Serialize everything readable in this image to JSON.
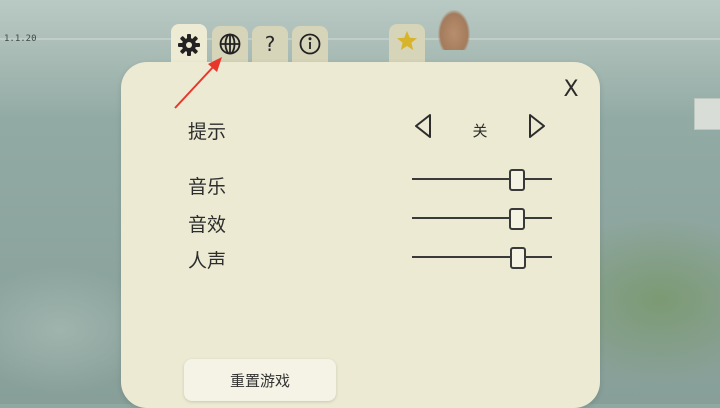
{
  "version": "1.1.20",
  "tabs": [
    {
      "id": "settings",
      "icon": "gear-icon"
    },
    {
      "id": "language",
      "icon": "globe-icon"
    },
    {
      "id": "help",
      "label": "?",
      "icon": "question-icon"
    },
    {
      "id": "info",
      "icon": "info-icon"
    }
  ],
  "star_tab": {
    "icon": "star-icon",
    "color": "#d8b42a"
  },
  "close_label": "X",
  "settings": {
    "hint": {
      "label": "提示",
      "value": "关"
    },
    "music": {
      "label": "音乐",
      "level": 0.75
    },
    "sfx": {
      "label": "音效",
      "level": 0.75
    },
    "voice": {
      "label": "人声",
      "level": 0.76
    }
  },
  "reset_button": "重置游戏",
  "colors": {
    "panel": "#ecead2",
    "annotation_arrow": "#e8362b"
  }
}
